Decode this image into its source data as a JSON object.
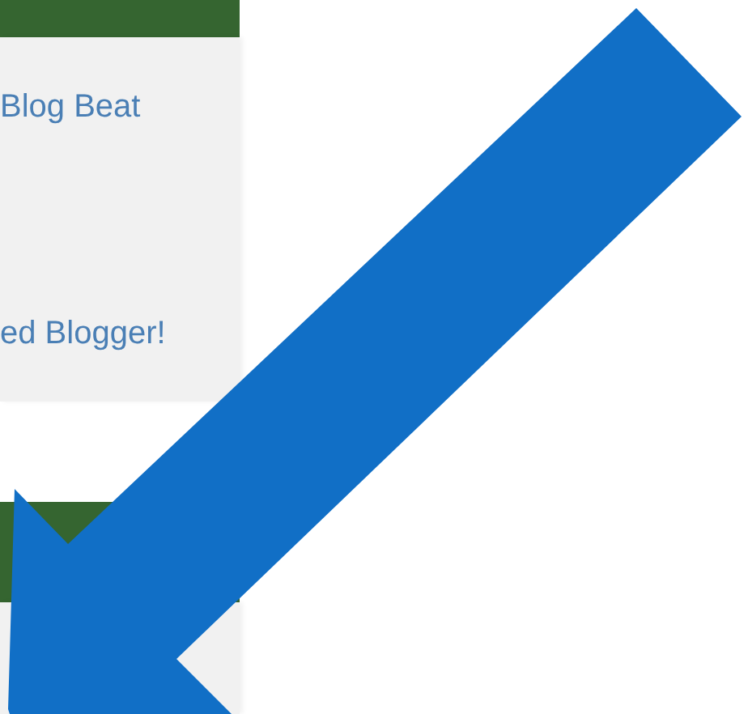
{
  "panels": [
    {
      "kind": "panel",
      "links": [
        "Blog Beat",
        "ed Blogger!"
      ]
    },
    {
      "kind": "panel"
    }
  ],
  "annotation": {
    "kind": "arrow"
  }
}
